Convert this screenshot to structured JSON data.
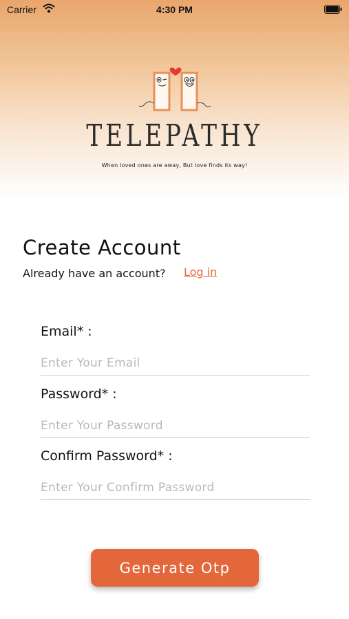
{
  "status_bar": {
    "carrier": "Carrier",
    "time": "4:30 PM"
  },
  "brand": {
    "title": "TELEPATHY",
    "tagline": "When loved ones are away, But love finds its way!"
  },
  "heading": {
    "title": "Create Account",
    "have_account": "Already have an account?",
    "login_link": "Log in"
  },
  "form": {
    "email_label": "Email* :",
    "email_placeholder": "Enter Your Email",
    "password_label": "Password* :",
    "password_placeholder": "Enter Your Password",
    "confirm_label": "Confirm Password* :",
    "confirm_placeholder": "Enter Your Confirm Password"
  },
  "actions": {
    "generate_otp": "Generate Otp"
  },
  "colors": {
    "accent": "#e4673b",
    "header_top": "#e9a66c"
  }
}
